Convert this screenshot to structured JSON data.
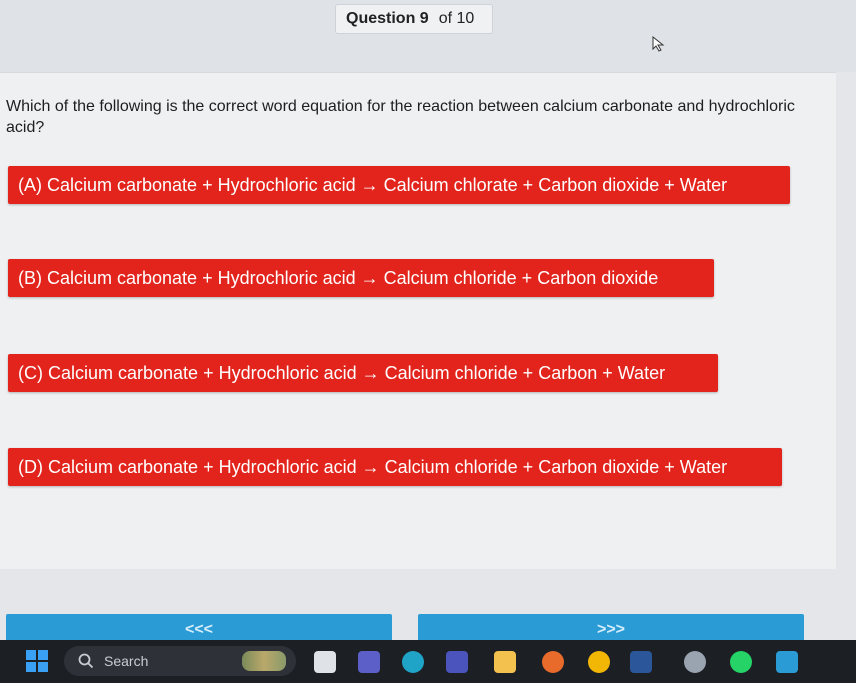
{
  "header": {
    "question_label": "Question 9",
    "of_label": "of 10"
  },
  "question": {
    "text": "Which of the following is the correct word equation for the reaction between calcium carbonate and hydrochloric acid?"
  },
  "options": [
    {
      "label": "(A) Calcium carbonate + Hydrochloric acid → Calcium chlorate + Carbon dioxide + Water"
    },
    {
      "label": "(B) Calcium carbonate + Hydrochloric acid → Calcium chloride + Carbon dioxide"
    },
    {
      "label": "(C) Calcium carbonate + Hydrochloric acid → Calcium chloride + Carbon + Water"
    },
    {
      "label": "(D) Calcium carbonate + Hydrochloric acid → Calcium chloride + Carbon dioxide + Water"
    }
  ],
  "nav": {
    "prev_label": "<<<",
    "next_label": ">>>"
  },
  "taskbar": {
    "search_placeholder": "Search",
    "apps": [
      "file-manager-icon",
      "teams-icon",
      "edge-icon",
      "teams-chat-icon",
      "folder-icon",
      "firefox-icon",
      "chrome-icon",
      "word-icon",
      "color-picker-icon",
      "whatsapp-icon",
      "app-icon"
    ]
  },
  "colors": {
    "option_bg": "#e2241c",
    "nav_bg": "#2a9bd5",
    "taskbar_bg": "#1c1f24"
  }
}
